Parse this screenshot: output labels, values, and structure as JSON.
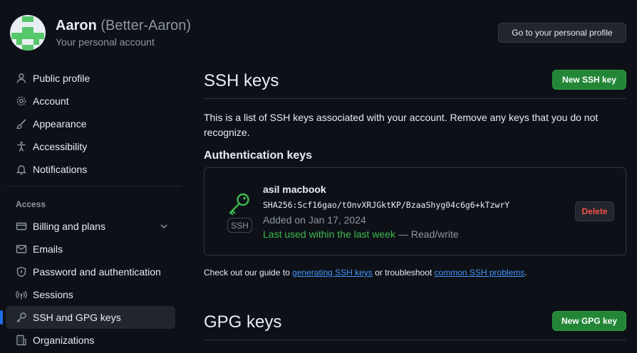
{
  "header": {
    "name": "Aaron",
    "login": "(Better-Aaron)",
    "subtitle": "Your personal account",
    "profile_button": "Go to your personal profile"
  },
  "sidebar": {
    "items_top": [
      {
        "label": "Public profile",
        "icon": "person-icon"
      },
      {
        "label": "Account",
        "icon": "gear-icon"
      },
      {
        "label": "Appearance",
        "icon": "paintbrush-icon"
      },
      {
        "label": "Accessibility",
        "icon": "accessibility-icon"
      },
      {
        "label": "Notifications",
        "icon": "bell-icon"
      }
    ],
    "access_heading": "Access",
    "items_access": [
      {
        "label": "Billing and plans",
        "icon": "credit-card-icon"
      },
      {
        "label": "Emails",
        "icon": "mail-icon"
      },
      {
        "label": "Password and authentication",
        "icon": "shield-lock-icon"
      },
      {
        "label": "Sessions",
        "icon": "broadcast-icon"
      },
      {
        "label": "SSH and GPG keys",
        "icon": "key-icon",
        "active": true
      },
      {
        "label": "Organizations",
        "icon": "organization-icon"
      }
    ]
  },
  "main": {
    "ssh_title": "SSH keys",
    "new_ssh_button": "New SSH key",
    "description": "This is a list of SSH keys associated with your account. Remove any keys that you do not recognize.",
    "auth_heading": "Authentication keys",
    "key": {
      "title": "asil macbook",
      "fingerprint": "SHA256:Scf16gao/tOnvXRJGktKP/BzaaShyg04c6g6+kTzwrY",
      "added": "Added on Jan 17, 2024",
      "last_used": "Last used within the last week",
      "separator": " — ",
      "access": "Read/write",
      "badge": "SSH",
      "delete_button": "Delete"
    },
    "guide": {
      "prefix": "Check out our guide to ",
      "link1": "generating SSH keys",
      "middle": " or troubleshoot ",
      "link2": "common SSH problems",
      "suffix": "."
    },
    "gpg_title": "GPG keys",
    "new_gpg_button": "New GPG key"
  },
  "colors": {
    "background": "#0d1117",
    "primary_button": "#238636",
    "link": "#4493f8",
    "danger": "#f85149",
    "success": "#3fb950",
    "active_indicator": "#1f6feb"
  }
}
